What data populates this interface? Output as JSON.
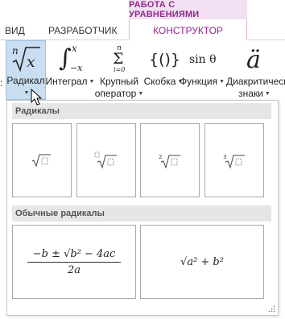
{
  "ribbon_tabs": {
    "contextual_header": "РАБОТА С УРАВНЕНИЯМИ",
    "tabs": [
      "ВИД",
      "РАЗРАБОТЧИК",
      "КОНСТРУКТОР"
    ]
  },
  "ribbon_buttons": {
    "radical": {
      "label": "Радикал",
      "icon_text": "ⁿ√x"
    },
    "integral": {
      "label": "Интеграл",
      "icon_text": "∫"
    },
    "large_operator": {
      "label_line1": "Крупный",
      "label_line2": "оператор",
      "icon_text": "Σ"
    },
    "bracket": {
      "label": "Скобка",
      "icon_text": "{()}"
    },
    "function": {
      "label": "Функция",
      "icon_text": "sin θ"
    },
    "accent": {
      "label_line1": "Диакритически",
      "label_line2": "знаки",
      "icon_text": "ä"
    }
  },
  "gallery": {
    "section_radicals": "Радикалы",
    "section_common": "Обычные радикалы",
    "common_formulas": [
      {
        "numerator": "−b ± √b² − 4ac",
        "denominator": "2a"
      },
      {
        "text": "√a² + b²"
      }
    ]
  },
  "colors": {
    "accent": "#8e2a8e",
    "contextual_bg": "#f3e0f3",
    "selected_button": "#c9def1"
  }
}
